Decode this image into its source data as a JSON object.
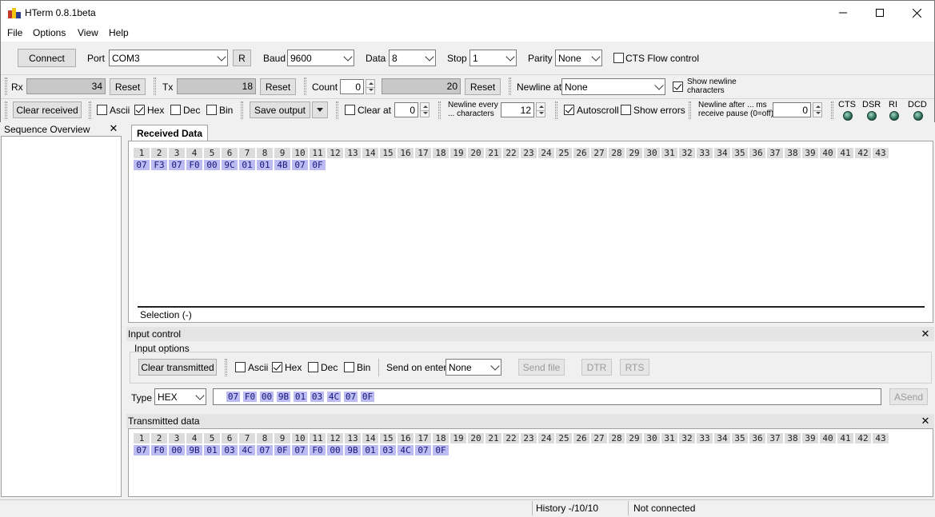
{
  "window": {
    "title": "HTerm 0.8.1beta",
    "minimize": "—",
    "maximize": "☐",
    "close": "✕"
  },
  "menu": [
    "File",
    "Options",
    "View",
    "Help"
  ],
  "toolbar1": {
    "connect": "Connect",
    "port_label": "Port",
    "port_value": "COM3",
    "refresh": "R",
    "baud_label": "Baud",
    "baud_value": "9600",
    "data_label": "Data",
    "data_value": "8",
    "stop_label": "Stop",
    "stop_value": "1",
    "parity_label": "Parity",
    "parity_value": "None",
    "cts_label": "CTS Flow control",
    "cts_checked": false
  },
  "toolbar2": {
    "rx_label": "Rx",
    "rx_value": "34",
    "rx_reset": "Reset",
    "tx_label": "Tx",
    "tx_value": "18",
    "tx_reset": "Reset",
    "count_label": "Count",
    "count_value": "0",
    "count_total": "20",
    "count_reset": "Reset",
    "newline_label": "Newline at",
    "newline_value": "None",
    "show_newline_line1": "Show newline",
    "show_newline_line2": "characters",
    "show_newline_checked": true
  },
  "toolbar3": {
    "clear_received": "Clear received",
    "ascii": "Ascii",
    "hex": "Hex",
    "dec": "Dec",
    "bin": "Bin",
    "save_output": "Save output",
    "clear_at": "Clear at",
    "clear_at_value": "0",
    "newline_every_line1": "Newline every",
    "newline_every_line2": "... characters",
    "newline_every_value": "12",
    "autoscroll": "Autoscroll",
    "show_errors": "Show errors",
    "newline_after_line1": "Newline after ... ms",
    "newline_after_line2": "receive pause (0=off)",
    "newline_after_value": "0",
    "signals": [
      "CTS",
      "DSR",
      "RI",
      "DCD"
    ]
  },
  "sequence_overview": {
    "title": "Sequence Overview",
    "close": "✕"
  },
  "received": {
    "tab": "Received Data",
    "headers": [
      "1",
      "2",
      "3",
      "4",
      "5",
      "6",
      "7",
      "8",
      "9",
      "10",
      "11",
      "12",
      "13",
      "14",
      "15",
      "16",
      "17",
      "18",
      "19",
      "20",
      "21",
      "22",
      "23",
      "24",
      "25",
      "26",
      "27",
      "28",
      "29",
      "30",
      "31",
      "32",
      "33",
      "34",
      "35",
      "36",
      "37",
      "38",
      "39",
      "40",
      "41",
      "42",
      "43"
    ],
    "bytes": [
      "07",
      "F3",
      "07",
      "F0",
      "00",
      "9C",
      "01",
      "01",
      "4B",
      "07",
      "0F"
    ],
    "selection": "Selection (-)"
  },
  "input_control": {
    "title": "Input control",
    "close": "✕",
    "options_label": "Input options",
    "clear_transmitted": "Clear transmitted",
    "ascii": "Ascii",
    "hex": "Hex",
    "dec": "Dec",
    "bin": "Bin",
    "send_on_enter_label": "Send on enter",
    "send_on_enter_value": "None",
    "send_file": "Send file",
    "dtr": "DTR",
    "rts": "RTS",
    "type_label": "Type",
    "type_value": "HEX",
    "input_bytes": [
      "07",
      "F0",
      "00",
      "9B",
      "01",
      "03",
      "4C",
      "07",
      "0F"
    ],
    "asend": "ASend"
  },
  "transmitted": {
    "title": "Transmitted data",
    "close": "✕",
    "headers": [
      "1",
      "2",
      "3",
      "4",
      "5",
      "6",
      "7",
      "8",
      "9",
      "10",
      "11",
      "12",
      "13",
      "14",
      "15",
      "16",
      "17",
      "18",
      "19",
      "20",
      "21",
      "22",
      "23",
      "24",
      "25",
      "26",
      "27",
      "28",
      "29",
      "30",
      "31",
      "32",
      "33",
      "34",
      "35",
      "36",
      "37",
      "38",
      "39",
      "40",
      "41",
      "42",
      "43"
    ],
    "bytes": [
      "07",
      "F0",
      "00",
      "9B",
      "01",
      "03",
      "4C",
      "07",
      "0F",
      "07",
      "F0",
      "00",
      "9B",
      "01",
      "03",
      "4C",
      "07",
      "0F"
    ]
  },
  "status": {
    "history": "History -/10/10",
    "connection": "Not connected"
  }
}
